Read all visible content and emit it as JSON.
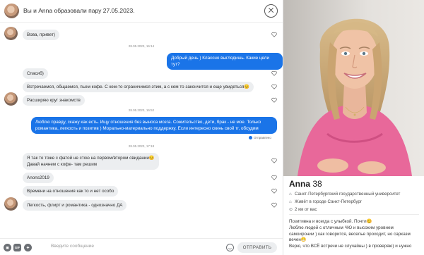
{
  "header": {
    "title": "Вы и Anna образовали пару 27.05.2023."
  },
  "messages": [
    {
      "text": "Вова, привет)"
    },
    {
      "time": "28.05.2023, 16:14"
    },
    {
      "text": "Добрый день ) Классно выглядишь. Какие цели тут?"
    },
    {
      "text": "Спасиб)"
    },
    {
      "text": "Встречаемся, общаемся, пьем кофе. С кем-то ограничимся этим, а с кем то закончится и еще увидеться😊"
    },
    {
      "text": "Расширяю круг знакомств"
    },
    {
      "time": "28.05.2023, 16:52"
    },
    {
      "line1": "Люблю правду, скажу как есть. Ищу отношения без выноса мозга. Сожительство, дети, брак - не мое. Только",
      "line2": "романтика, легкость и позитив ) Морально-материально поддержку. Если интересно скинь свой тг, обсудим"
    },
    {
      "status": "Отправлено"
    },
    {
      "time": "28.05.2023, 17:18"
    },
    {
      "line1": "Я так то тоже с фатой не стою на первом/втором свидании😊",
      "line2": "Давай начнем с кофе- там решим"
    },
    {
      "text": "Anons2019"
    },
    {
      "text": "Времени на отношения как то и нет особо"
    },
    {
      "text": "Легкость, флирт и романтика - однозначно ДА"
    }
  ],
  "composer": {
    "placeholder": "Введите сообщение",
    "send_label": "ОТПРАВИТЬ",
    "icons": [
      "photo-icon",
      "gif-icon",
      "gift-icon"
    ],
    "gif_label": "GIF"
  },
  "profile": {
    "name": "Anna",
    "age": "38",
    "university": "Санкт-Петербургский государственный университет",
    "city": "Живёт в городе Санкт-Петербург",
    "distance": "2 км от вас",
    "bio": [
      "Позитивна и всегда с улыбкой. Почти😊",
      "Люблю людей с отличным ЧЮ и высоким уровнем",
      "самоиронии ) как говорится, веселье проходит, но сарказм",
      "вечен😁",
      "Верю, что ВСЁ встречи не случайны ) в проверяю) и нужно"
    ]
  },
  "colors": {
    "outgoing_bubble": "#1a74e8",
    "incoming_bubble": "#eceef0",
    "shirt": "#e8689a"
  }
}
